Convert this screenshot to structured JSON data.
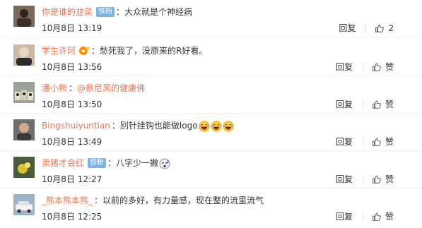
{
  "comments": [
    {
      "user": "你是谁的韭菜",
      "badge": "铁粉",
      "has_vip_icon": false,
      "text_prefix": "大众就是个神经病",
      "mention": "",
      "emoji_count": 0,
      "emoji_name": "",
      "date": "10月8日",
      "time": "13:19",
      "reply_label": "回复",
      "like_label": "2",
      "avatar_bg": "#7a6a5a"
    },
    {
      "user": "学生许珂",
      "badge": "",
      "has_vip_icon": true,
      "text_prefix": "愁死我了，没原来的R好看。",
      "mention": "",
      "emoji_count": 0,
      "emoji_name": "",
      "date": "10月8日",
      "time": "13:56",
      "reply_label": "回复",
      "like_label": "赞",
      "avatar_bg": "#c9b9a6"
    },
    {
      "user": "潘小熊",
      "badge": "",
      "has_vip_icon": false,
      "text_prefix": "",
      "mention": "@蔡尼黑的健康佛",
      "emoji_count": 0,
      "emoji_name": "",
      "date": "10月8日",
      "time": "13:50",
      "reply_label": "回复",
      "like_label": "赞",
      "avatar_bg": "#9aa39a"
    },
    {
      "user": "Bingshuiyuntian",
      "badge": "",
      "has_vip_icon": false,
      "text_prefix": "别针挂钩也能做logo",
      "mention": "",
      "emoji_count": 3,
      "emoji_name": "laughing-emoji",
      "date": "10月8日",
      "time": "13:49",
      "reply_label": "回复",
      "like_label": "赞",
      "avatar_bg": "#6f6f6f"
    },
    {
      "user": "卖猪才会红",
      "badge": "铁粉",
      "has_vip_icon": false,
      "text_prefix": "八字少一撇",
      "mention": "",
      "emoji_count": 1,
      "emoji_name": "dizzy-emoji",
      "date": "10月8日",
      "time": "12:27",
      "reply_label": "回复",
      "like_label": "赞",
      "avatar_bg": "#4d5b3a"
    },
    {
      "user": "_熊本熊本熊_",
      "badge": "",
      "has_vip_icon": false,
      "text_prefix": "以前的多好，有力量感，现在整的流里流气",
      "mention": "",
      "emoji_count": 0,
      "emoji_name": "",
      "date": "10月8日",
      "time": "12:25",
      "reply_label": "回复",
      "like_label": "赞",
      "avatar_bg": "#9fb3c8"
    }
  ],
  "colors": {
    "username": "#eb7350",
    "badge_bg": "#7db3e3",
    "text": "#333333",
    "divider": "#eeeeee"
  },
  "icons": {
    "like": "thumbs-up-icon",
    "vip": "vip-crown-icon"
  }
}
